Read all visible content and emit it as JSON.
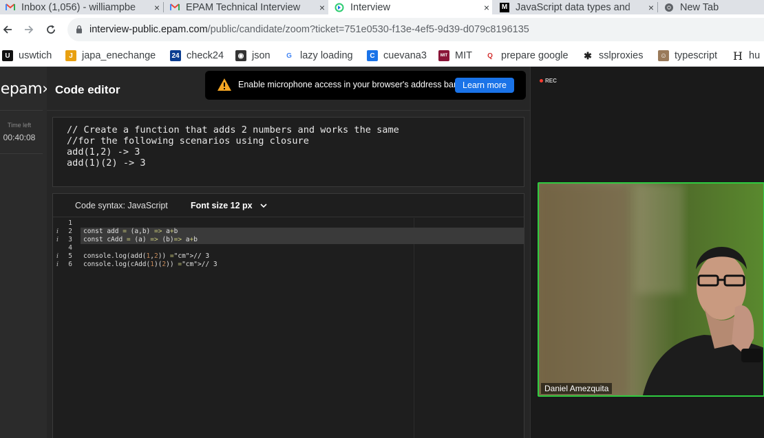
{
  "browser": {
    "tabs": [
      {
        "title": "Inbox (1,056) - williampbe",
        "favicon": "gmail-icon",
        "close": "×"
      },
      {
        "title": "EPAM Technical Interview",
        "favicon": "gmail-icon",
        "close": "×"
      },
      {
        "title": "Interview",
        "favicon": "interview-app-icon",
        "close": "×"
      },
      {
        "title": "JavaScript data types and",
        "favicon": "mdn-icon",
        "close": "×"
      },
      {
        "title": "New Tab",
        "favicon": "chrome-icon"
      }
    ],
    "url_host": "interview-public.epam.com",
    "url_path": "/public/candidate/zoom?ticket=751e0530-f13e-4ef5-9d39-d079c8196135",
    "bookmarks": [
      {
        "label": "uswtich",
        "icon": "uswitch-icon",
        "color": "#111111",
        "glyph": "U"
      },
      {
        "label": "japa_enechange",
        "icon": "enechange-icon",
        "color": "#e8a010",
        "glyph": "J"
      },
      {
        "label": "check24",
        "icon": "check24-icon",
        "color": "#0b3d91",
        "glyph": "24"
      },
      {
        "label": "json",
        "icon": "json-icon",
        "color": "#333333",
        "glyph": "◉"
      },
      {
        "label": "lazy loading",
        "icon": "google-icon",
        "color": "#ffffff",
        "glyph": "G"
      },
      {
        "label": "cuevana3",
        "icon": "cuevana-icon",
        "color": "#1a73e8",
        "glyph": "C"
      },
      {
        "label": "MIT",
        "icon": "mit-icon",
        "color": "#8a1538",
        "glyph": "MIT"
      },
      {
        "label": "prepare google",
        "icon": "quora-icon",
        "color": "#ffffff",
        "glyph": "Q"
      },
      {
        "label": "sslproxies",
        "icon": "sslproxies-icon",
        "color": "#ffffff",
        "glyph": "✱"
      },
      {
        "label": "typescript",
        "icon": "typescript-icon",
        "color": "#9a7a5a",
        "glyph": "☺"
      },
      {
        "label": "hu",
        "icon": "h-icon",
        "color": "#ffffff",
        "glyph": "H"
      }
    ]
  },
  "app": {
    "logo": "‹epam›",
    "time_left_label": "Time left",
    "time_left_value": "00:40:08",
    "editor_title": "Code editor",
    "mic_banner_text": "Enable microphone access in your browser's address bar.",
    "learn_more": "Learn more",
    "task_lines": [
      "// Create a function that adds 2 numbers and works the same",
      "//for the following scenarios using closure",
      "add(1,2) -> 3",
      "add(1)(2) -> 3"
    ],
    "syntax_label": "Code syntax: JavaScript",
    "font_size_label": "Font size 12 px",
    "gutter": [
      {
        "num": "1",
        "info": ""
      },
      {
        "num": "2",
        "info": "i"
      },
      {
        "num": "3",
        "info": "i"
      },
      {
        "num": "4",
        "info": ""
      },
      {
        "num": "5",
        "info": "i"
      },
      {
        "num": "6",
        "info": "i"
      }
    ],
    "code_lines": [
      "",
      "const add = (a,b) => a+b",
      "const cAdd = (a) => (b)=> a+b",
      "",
      "console.log(add(1,2)) // 3",
      "console.log(cAdd(1)(2)) // 3"
    ],
    "rec_label": "REC",
    "participant_name": "Daniel Amezquita",
    "accent": "#2ecc40",
    "button_blue": "#1a73e8"
  }
}
